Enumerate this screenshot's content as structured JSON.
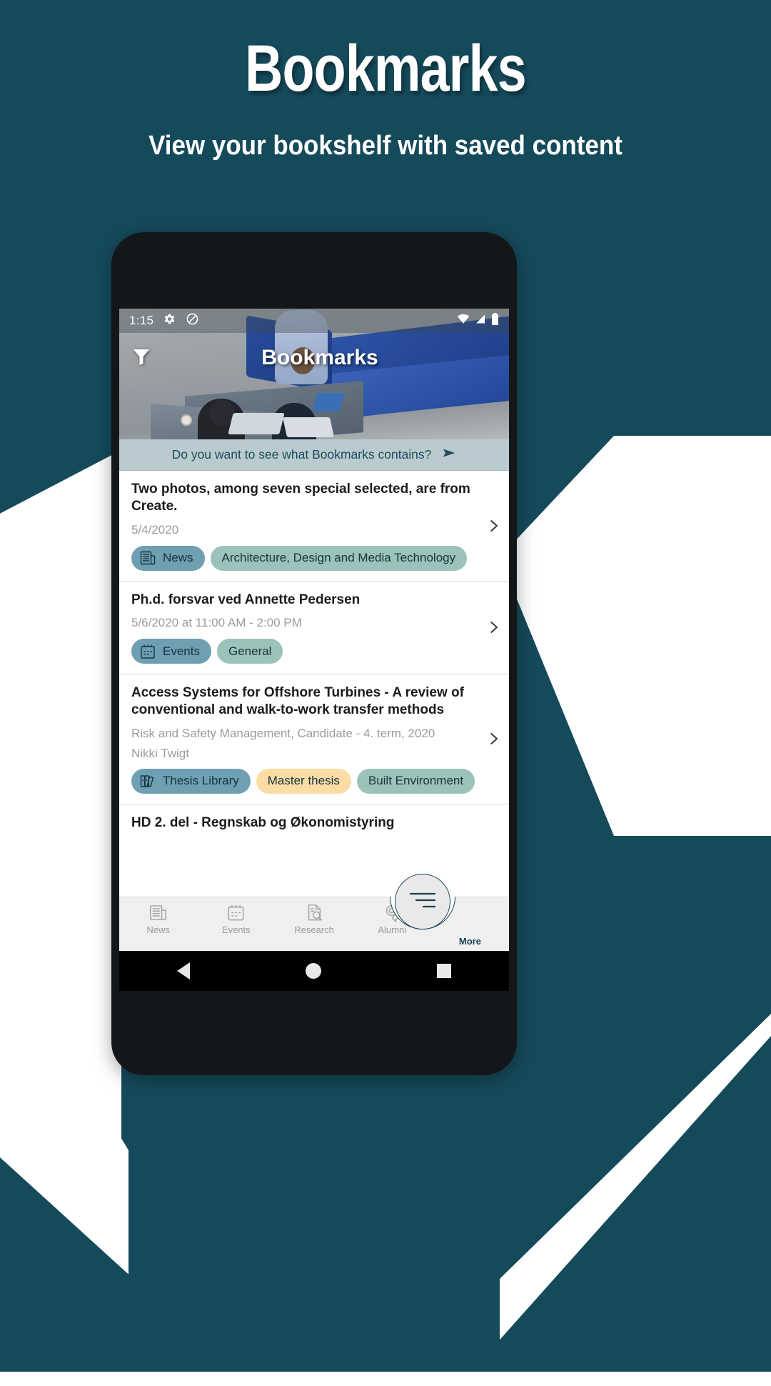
{
  "store": {
    "title": "Bookmarks",
    "subtitle": "View your bookshelf with saved content",
    "bg_color": "#154a5b"
  },
  "phone": {
    "statusbar": {
      "time": "1:15",
      "left_icons": [
        "gear-icon",
        "do-not-disturb-icon"
      ],
      "right_icons": [
        "wifi-icon",
        "signal-icon",
        "battery-icon"
      ]
    },
    "appbar": {
      "title": "Bookmarks",
      "filter_icon": "filter-icon"
    },
    "banner": {
      "text": "Do you want to see what Bookmarks contains?",
      "arrow_icon": "arrow-right-icon",
      "bg_color": "#b9cbd0",
      "text_color": "#1d4b58"
    },
    "list": [
      {
        "title": "Two photos, among seven special selected, are from Create.",
        "meta": "5/4/2020",
        "meta2": "",
        "chips": [
          {
            "label": "News",
            "kind": "cat",
            "icon": "newspaper-icon"
          },
          {
            "label": "Architecture, Design and Media Technology",
            "kind": "dept",
            "icon": ""
          }
        ]
      },
      {
        "title": "Ph.d. forsvar ved Annette Pedersen",
        "meta": "5/6/2020 at 11:00 AM - 2:00 PM",
        "meta2": "",
        "chips": [
          {
            "label": "Events",
            "kind": "cat",
            "icon": "calendar-icon"
          },
          {
            "label": "General",
            "kind": "dept",
            "icon": ""
          }
        ]
      },
      {
        "title": "Access Systems for Offshore Turbines - A review of conventional and walk-to-work transfer methods",
        "meta": "Risk and Safety Management, Candidate - 4. term, 2020",
        "meta2": "Nikki Twigt",
        "chips": [
          {
            "label": "Thesis Library",
            "kind": "cat",
            "icon": "books-icon"
          },
          {
            "label": "Master thesis",
            "kind": "type",
            "icon": ""
          },
          {
            "label": "Built Environment",
            "kind": "dept",
            "icon": ""
          }
        ]
      },
      {
        "title": "HD 2. del - Regnskab og Økonomistyring",
        "meta": "",
        "meta2": "",
        "chips": []
      }
    ],
    "bottomnav": [
      {
        "label": "News",
        "icon": "newspaper-icon"
      },
      {
        "label": "Events",
        "icon": "calendar-icon"
      },
      {
        "label": "Research",
        "icon": "research-icon"
      },
      {
        "label": "Alumni",
        "icon": "award-icon"
      },
      {
        "label": "More",
        "icon": "more-lines-icon"
      }
    ],
    "systembar": [
      "back-icon",
      "home-icon",
      "recents-icon"
    ]
  },
  "colors": {
    "chip_cat": "#6e9fb3",
    "chip_dept": "#9cc3bb",
    "chip_type": "#fbdca5",
    "accent": "#17414f"
  }
}
